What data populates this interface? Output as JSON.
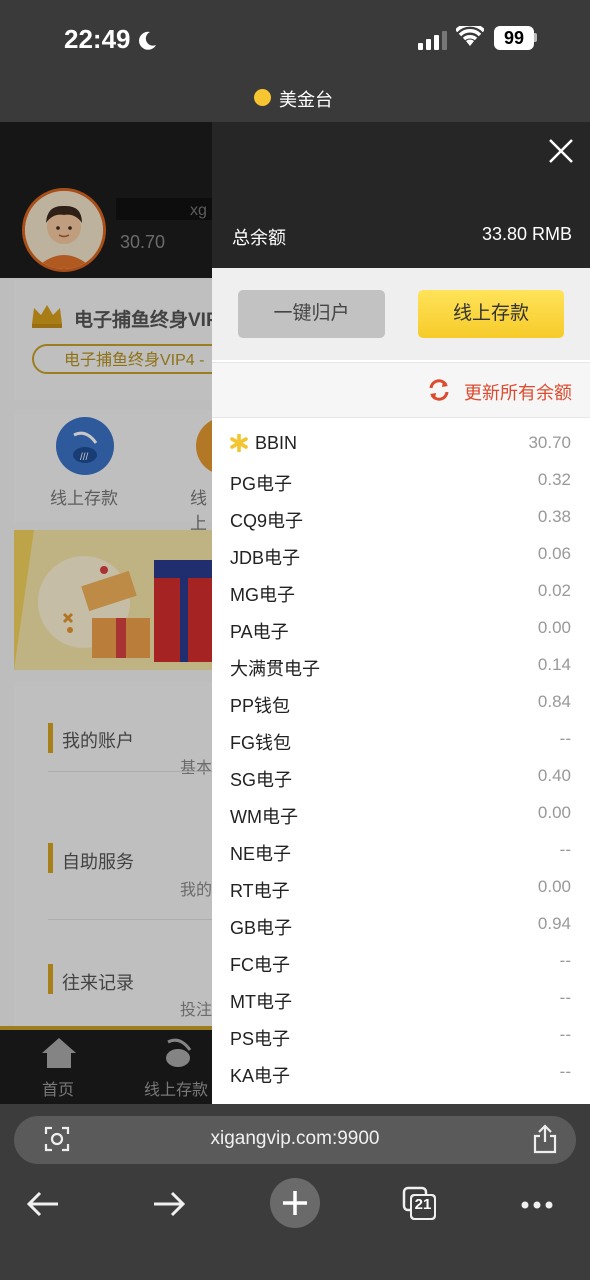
{
  "status_bar": {
    "time": "22:49",
    "battery": "99",
    "site_name": "美金台"
  },
  "background_page": {
    "username_tail": "xg",
    "balance": "30.70",
    "vip_title": "电子捕鱼终身VIP",
    "vip_pill": "电子捕鱼终身VIP4 -",
    "quick_deposit_label": "线上存款",
    "quick_second_label": "线上",
    "menu": [
      {
        "label": "我的账户",
        "sub": "基本"
      },
      {
        "label": "自助服务",
        "sub": "我的"
      },
      {
        "label": "往来记录",
        "sub": "投注"
      }
    ],
    "bottom_nav": {
      "home": "首页",
      "deposit": "线上存款"
    }
  },
  "drawer": {
    "total_label": "总余额",
    "total_value": "33.80 RMB",
    "collect_button": "一键归户",
    "deposit_button": "线上存款",
    "refresh_label": "更新所有余额",
    "games": [
      {
        "name": "BBIN",
        "value": "30.70",
        "starred": true
      },
      {
        "name": "PG电子",
        "value": "0.32"
      },
      {
        "name": "CQ9电子",
        "value": "0.38"
      },
      {
        "name": "JDB电子",
        "value": "0.06"
      },
      {
        "name": "MG电子",
        "value": "0.02"
      },
      {
        "name": "PA电子",
        "value": "0.00"
      },
      {
        "name": "大满贯电子",
        "value": "0.14"
      },
      {
        "name": "PP钱包",
        "value": "0.84"
      },
      {
        "name": "FG钱包",
        "value": "--"
      },
      {
        "name": "SG电子",
        "value": "0.40"
      },
      {
        "name": "WM电子",
        "value": "0.00"
      },
      {
        "name": "NE电子",
        "value": "--"
      },
      {
        "name": "RT电子",
        "value": "0.00"
      },
      {
        "name": "GB电子",
        "value": "0.94"
      },
      {
        "name": "FC电子",
        "value": "--"
      },
      {
        "name": "MT电子",
        "value": "--"
      },
      {
        "name": "PS电子",
        "value": "--"
      },
      {
        "name": "KA电子",
        "value": "--"
      }
    ]
  },
  "browser": {
    "url": "xigangvip.com:9900",
    "tab_count": "21"
  },
  "colors": {
    "accent_yellow": "#f6cb2a",
    "refresh_red": "#dd4b2e",
    "drawer_header": "#262626"
  }
}
